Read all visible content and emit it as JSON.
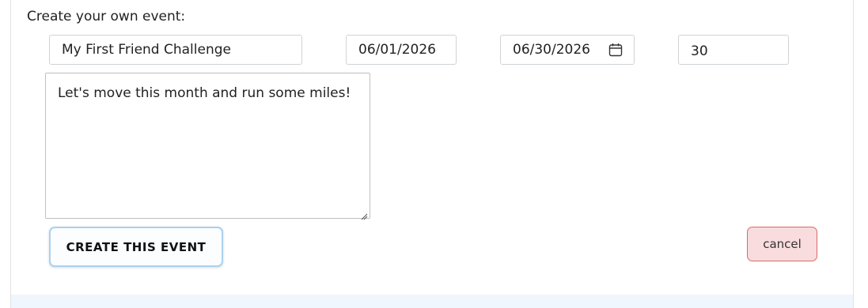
{
  "form": {
    "title": "Create your own event:",
    "event_name": "My First Friend Challenge",
    "start_date": "06/01/2026",
    "end_date": "06/30/2026",
    "goal": "30",
    "description": "Let's move this month and run some miles!",
    "create_label": "CREATE THIS EVENT",
    "cancel_label": "cancel"
  },
  "icons": {
    "calendar": "calendar-icon",
    "resize": "resize-handle-icon"
  },
  "colors": {
    "create_border": "#a9d2ef",
    "cancel_bg": "#f9dcde",
    "cancel_border": "#d96a66"
  }
}
